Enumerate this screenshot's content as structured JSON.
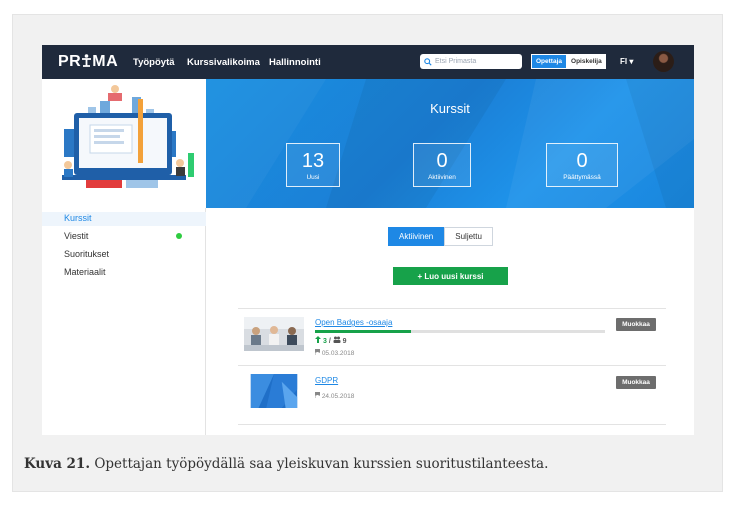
{
  "nav": {
    "logo_text": "PR",
    "logo_accent": "MA",
    "links": [
      "Työpöytä",
      "Kurssivalikoima",
      "Hallinnointi"
    ],
    "search_placeholder": "Etsi Primasta",
    "role_active": "Opettaja",
    "role_inactive": "Opiskelija",
    "language": "FI ▾"
  },
  "hero": {
    "title": "Kurssit",
    "stats": [
      {
        "value": "13",
        "label": "Uusi"
      },
      {
        "value": "0",
        "label": "Aktiivinen"
      },
      {
        "value": "0",
        "label": "Päättymässä"
      }
    ]
  },
  "sidebar": {
    "items": [
      "Kurssit",
      "Viestit",
      "Suoritukset",
      "Materiaalit"
    ]
  },
  "tabs": {
    "active": "Aktiivinen",
    "inactive": "Suljettu"
  },
  "create_button": "+ Luo uusi kurssi",
  "courses": [
    {
      "title": "Open Badges -osaaja",
      "completed": "3",
      "total": "9",
      "date": "05.03.2018",
      "progress_pct": 33,
      "edit": "Muokkaa"
    },
    {
      "title": "GDPR",
      "date": "24.05.2018",
      "edit": "Muokkaa"
    }
  ],
  "caption": {
    "label": "Kuva 21.",
    "text": " Opettajan työpöydällä saa yleiskuvan kurssien suoritustilanteesta."
  },
  "colors": {
    "nav_bg": "#1f2a3c",
    "accent": "#1e88e5",
    "success": "#17a24a",
    "edit_button": "#6d6d6d"
  }
}
